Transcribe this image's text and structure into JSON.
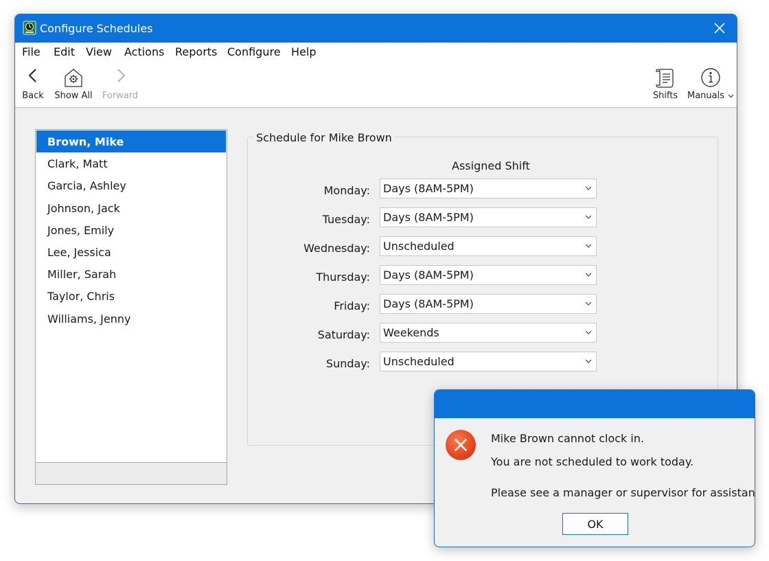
{
  "window": {
    "title": "Configure Schedules"
  },
  "menu": [
    "File",
    "Edit",
    "View",
    "Actions",
    "Reports",
    "Configure",
    "Help"
  ],
  "toolbar": {
    "back": "Back",
    "show_all": "Show All",
    "forward": "Forward",
    "shifts": "Shifts",
    "manuals": "Manuals"
  },
  "employees": [
    "Brown, Mike",
    "Clark, Matt",
    "Garcia, Ashley",
    "Johnson, Jack",
    "Jones, Emily",
    "Lee, Jessica",
    "Miller, Sarah",
    "Taylor, Chris",
    "Williams, Jenny"
  ],
  "selected_employee": "Brown, Mike",
  "schedule": {
    "title": "Schedule for Mike Brown",
    "column_header": "Assigned Shift",
    "days": [
      {
        "day": "Monday:",
        "shift": "Days (8AM-5PM)"
      },
      {
        "day": "Tuesday:",
        "shift": "Days (8AM-5PM)"
      },
      {
        "day": "Wednesday:",
        "shift": "Unscheduled"
      },
      {
        "day": "Thursday:",
        "shift": "Days (8AM-5PM)"
      },
      {
        "day": "Friday:",
        "shift": "Days (8AM-5PM)"
      },
      {
        "day": "Saturday:",
        "shift": "Weekends"
      },
      {
        "day": "Sunday:",
        "shift": "Unscheduled"
      }
    ]
  },
  "dialog": {
    "line1": "Mike Brown cannot clock in.",
    "line2": "You are not scheduled to work today.",
    "line3": "Please see a manager or supervisor for assistance.",
    "ok_label": "OK"
  },
  "colors": {
    "accent": "#0b73d9",
    "error": "#e8401c"
  }
}
